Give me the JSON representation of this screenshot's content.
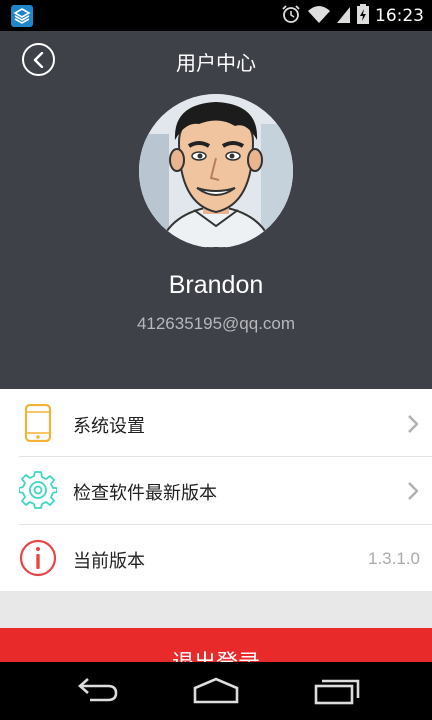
{
  "status_bar": {
    "time": "16:23",
    "icons": [
      "app-notification-icon",
      "alarm-icon",
      "wifi-icon",
      "signal-icon",
      "battery-icon"
    ]
  },
  "header": {
    "title": "用户中心",
    "username": "Brandon",
    "email": "412635195@qq.com",
    "background": "#3f4148"
  },
  "menu": {
    "items": [
      {
        "label": "系统设置",
        "icon": "phone-icon",
        "icon_color": "#f5b335"
      },
      {
        "label": "检查软件最新版本",
        "icon": "gear-icon",
        "icon_color": "#3fd6c4"
      },
      {
        "label": "当前版本",
        "icon": "info-icon",
        "icon_color": "#e84646",
        "value": "1.3.1.0"
      }
    ]
  },
  "logout": {
    "label": "退出登录",
    "color": "#e82a2a"
  },
  "nav": {
    "icons": [
      "back-nav-icon",
      "home-nav-icon",
      "recents-nav-icon"
    ]
  }
}
